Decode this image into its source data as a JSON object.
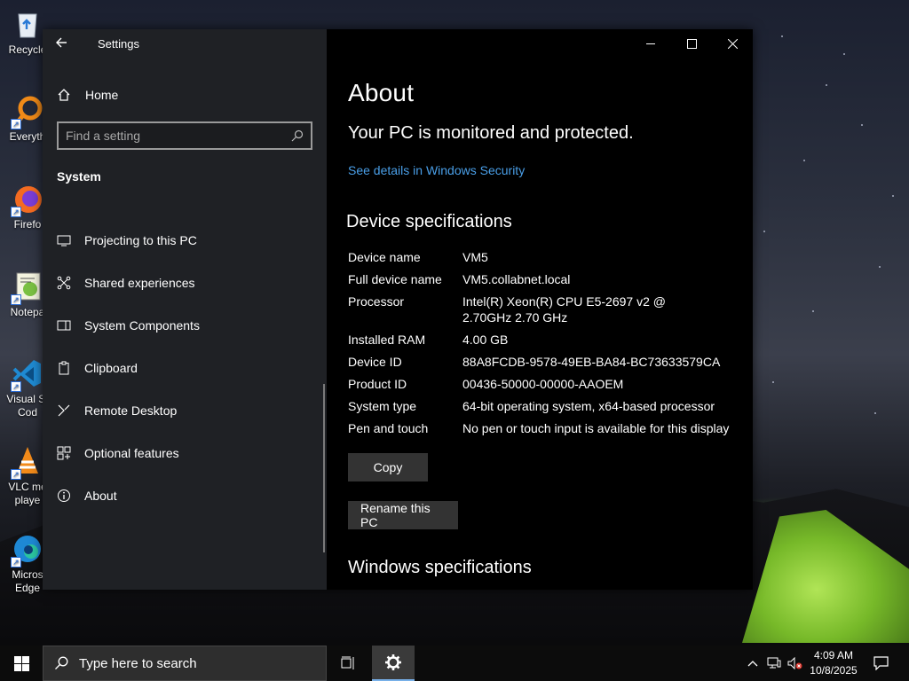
{
  "desktop": {
    "icons": [
      {
        "label": "Recycle",
        "icon": "recycle-bin-icon"
      },
      {
        "label": "Everyth",
        "icon": "everything-search-icon"
      },
      {
        "label": "Firefo",
        "icon": "firefox-icon"
      },
      {
        "label": "Notepa",
        "icon": "notepad-icon"
      },
      {
        "label": "Visual St Cod",
        "icon": "vscode-icon"
      },
      {
        "label": "VLC me playe",
        "icon": "vlc-icon"
      },
      {
        "label": "Micros Edge",
        "icon": "edge-icon"
      }
    ]
  },
  "settings": {
    "window_title": "Settings",
    "nav": {
      "home_label": "Home",
      "search_placeholder": "Find a setting",
      "section_title": "System",
      "items": [
        {
          "label": "Projecting to this PC",
          "icon": "projector-icon"
        },
        {
          "label": "Shared experiences",
          "icon": "shared-experiences-icon"
        },
        {
          "label": "System Components",
          "icon": "components-icon"
        },
        {
          "label": "Clipboard",
          "icon": "clipboard-icon"
        },
        {
          "label": "Remote Desktop",
          "icon": "remote-desktop-icon"
        },
        {
          "label": "Optional features",
          "icon": "optional-features-icon"
        },
        {
          "label": "About",
          "icon": "info-icon"
        }
      ]
    },
    "content": {
      "page_title": "About",
      "protection_status": "Your PC is monitored and protected.",
      "security_link": "See details in Windows Security",
      "device_specs_title": "Device specifications",
      "specs": [
        {
          "key": "Device name",
          "value": "VM5"
        },
        {
          "key": "Full device name",
          "value": "VM5.collabnet.local"
        },
        {
          "key": "Processor",
          "value": "Intel(R) Xeon(R) CPU E5-2697 v2 @ 2.70GHz 2.70 GHz"
        },
        {
          "key": "Installed RAM",
          "value": "4.00 GB"
        },
        {
          "key": "Device ID",
          "value": "88A8FCDB-9578-49EB-BA84-BC73633579CA"
        },
        {
          "key": "Product ID",
          "value": "00436-50000-00000-AAOEM"
        },
        {
          "key": "System type",
          "value": "64-bit operating system, x64-based processor"
        },
        {
          "key": "Pen and touch",
          "value": "No pen or touch input is available for this display"
        }
      ],
      "copy_button": "Copy",
      "rename_button": "Rename this PC",
      "windows_specs_title": "Windows specifications"
    }
  },
  "taskbar": {
    "search_placeholder": "Type here to search",
    "time": "4:09 AM",
    "date": "10/8/2025"
  },
  "colors": {
    "link": "#4a9fe8",
    "accent": "#78b0e8"
  }
}
